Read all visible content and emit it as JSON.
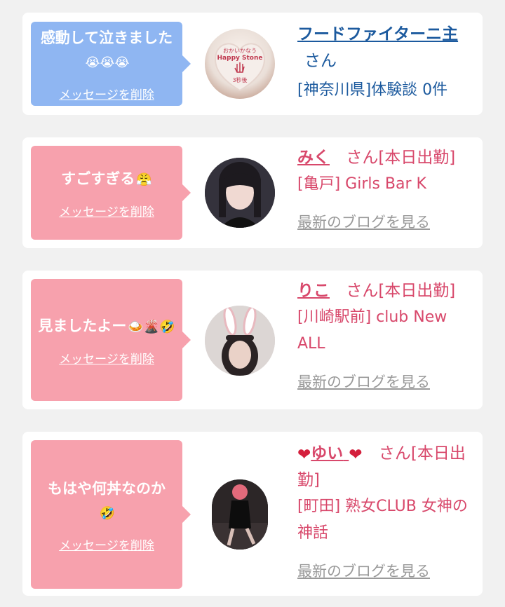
{
  "cards": [
    {
      "message": "感動して泣きました",
      "message_emoji": "😭😭😭",
      "delete_label": "メッセージを削除",
      "name": "フードファイターニ主",
      "san": "さん",
      "details": "[神奈川県]体験談 0件",
      "avatar_text_1": "おかいかなう",
      "avatar_text_2": "Happy Stone",
      "avatar_text_3": "3秒後"
    },
    {
      "message": "すごすぎる",
      "message_emoji": "😤",
      "delete_label": "メッセージを削除",
      "name": "みく",
      "san": "さん[本日出勤]",
      "details": "[亀戸] Girls Bar K",
      "blog_label": "最新のブログを見る"
    },
    {
      "message": "見ましたよー",
      "message_emoji": "🍛🌋🤣",
      "delete_label": "メッセージを削除",
      "name": "りこ",
      "san": "さん[本日出勤]",
      "details": "[川崎駅前] club New ALL",
      "blog_label": "最新のブログを見る"
    },
    {
      "message": "もはや何丼なのか",
      "message_emoji": "🤣",
      "delete_label": "メッセージを削除",
      "name": "ゆい",
      "name_prefix": "❤",
      "name_suffix": "❤",
      "san": "さん[本日出勤]",
      "details": "[町田] 熟女CLUB 女神の神話",
      "blog_label": "最新のブログを見る"
    }
  ],
  "colors": {
    "blue_bubble": "#8fb6f2",
    "pink_bubble": "#f7a1ad",
    "blue_text": "#1c5a9e",
    "pink_text": "#d8486b",
    "link_gray": "#9a9a9a"
  }
}
